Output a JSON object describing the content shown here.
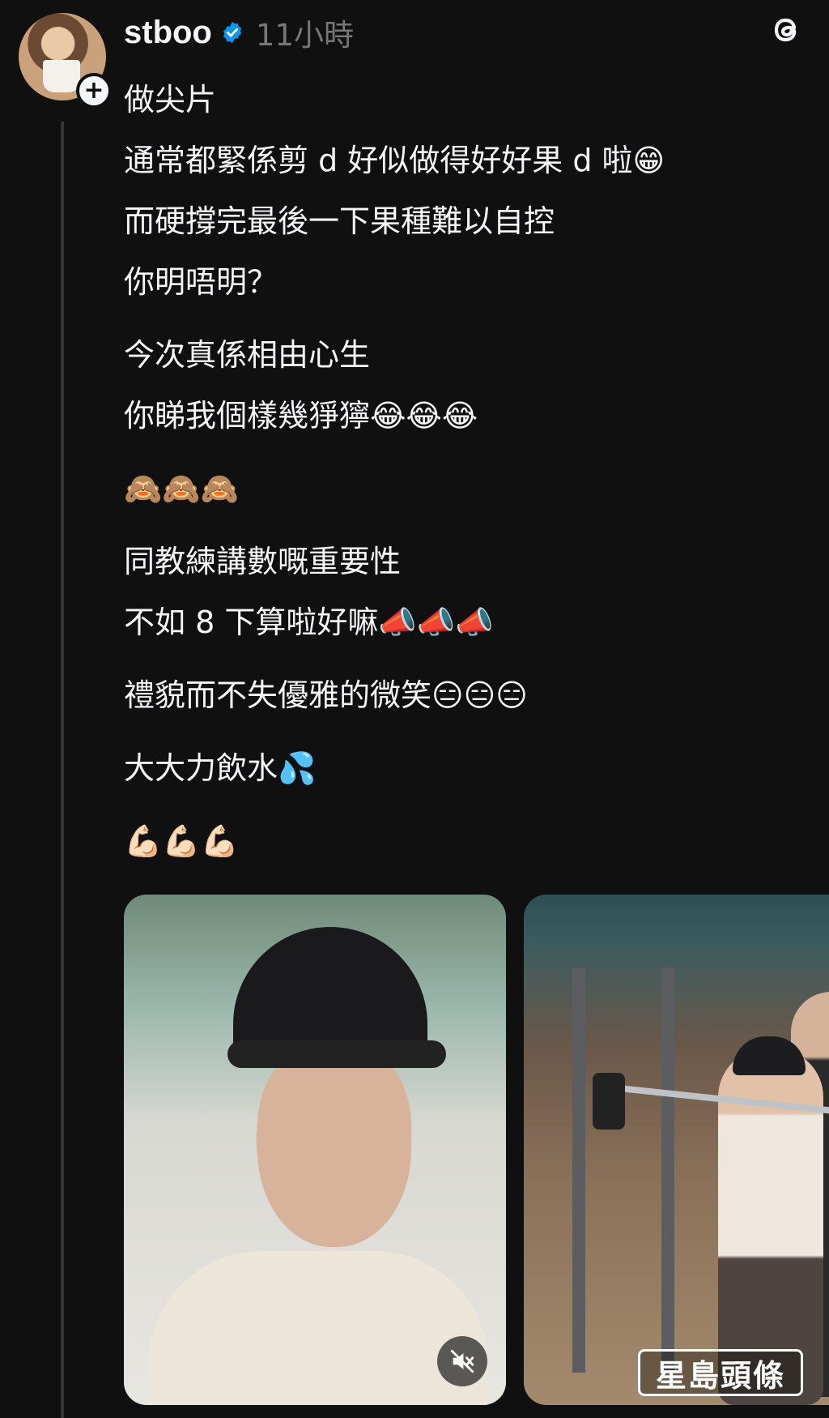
{
  "post": {
    "username": "stboo",
    "timestamp": "11小時",
    "icons": {
      "verified": "verified-badge-icon",
      "follow": "plus-icon",
      "app": "threads-logo-icon",
      "mute": "speaker-muted-icon"
    },
    "colors": {
      "background": "#101010",
      "text": "#f3f5f7",
      "muted": "#777777",
      "verified": "#0095f6",
      "thread_line": "#333638"
    },
    "paragraphs": [
      [
        "做尖片",
        "通常都緊係剪 d 好似做得好好果 d 啦😁"
      ],
      [
        "而硬撐完最後一下果種難以自控",
        "你明唔明？"
      ],
      [
        "今次真係相由心生",
        "你睇我個樣幾猙獰😂😂😂"
      ],
      [
        "🙈🙈🙈"
      ],
      [
        "同教練講數嘅重要性",
        "不如 8 下算啦好嘛📣📣📣"
      ],
      [
        "禮貌而不失優雅的微笑😑😑😑"
      ],
      [
        "大大力飲水💦"
      ],
      [
        "💪🏻💪🏻💪🏻"
      ]
    ],
    "media": [
      {
        "kind": "video"
      },
      {
        "kind": "video"
      }
    ]
  },
  "watermark": "星島頭條"
}
